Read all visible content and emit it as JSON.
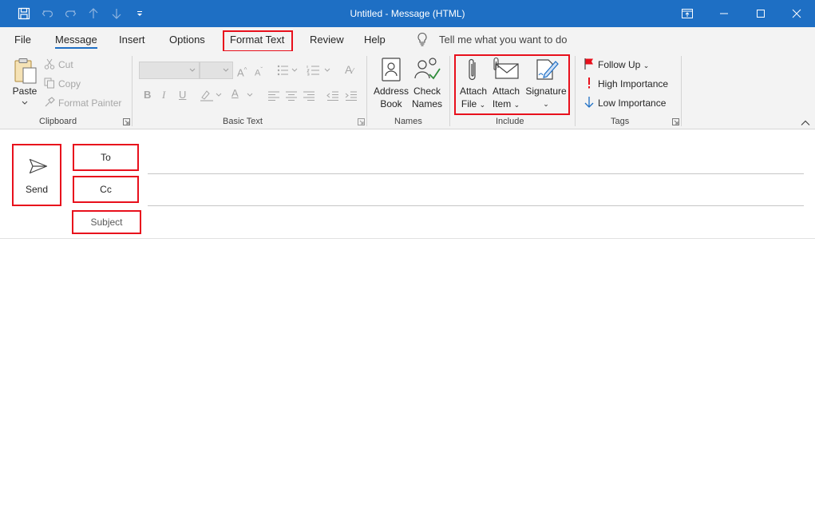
{
  "window": {
    "title": "Untitled  -  Message (HTML)"
  },
  "menu": {
    "tabs": [
      "File",
      "Message",
      "Insert",
      "Options",
      "Format Text",
      "Review",
      "Help"
    ],
    "active": "Message",
    "tell_me": "Tell me what you want to do"
  },
  "ribbon": {
    "clipboard": {
      "group_label": "Clipboard",
      "paste": "Paste",
      "cut": "Cut",
      "copy": "Copy",
      "format_painter": "Format Painter"
    },
    "basic_text": {
      "group_label": "Basic Text",
      "bold": "B",
      "italic": "I",
      "underline": "U"
    },
    "names": {
      "group_label": "Names",
      "address_book_1": "Address",
      "address_book_2": "Book",
      "check_names_1": "Check",
      "check_names_2": "Names"
    },
    "include": {
      "group_label": "Include",
      "attach_file_1": "Attach",
      "attach_file_2": "File",
      "attach_item_1": "Attach",
      "attach_item_2": "Item",
      "signature": "Signature"
    },
    "tags": {
      "group_label": "Tags",
      "follow_up": "Follow Up",
      "high_importance": "High Importance",
      "low_importance": "Low Importance"
    }
  },
  "compose": {
    "send": "Send",
    "to": "To",
    "cc": "Cc",
    "subject": "Subject",
    "to_value": "",
    "cc_value": "",
    "subject_value": ""
  },
  "colors": {
    "titlebar": "#1e6fc4",
    "highlight": "#e8101c",
    "ribbon_bg": "#f3f3f3",
    "follow_up_flag": "#e8101c",
    "high_importance": "#e8101c",
    "low_importance": "#1e6fc4"
  }
}
